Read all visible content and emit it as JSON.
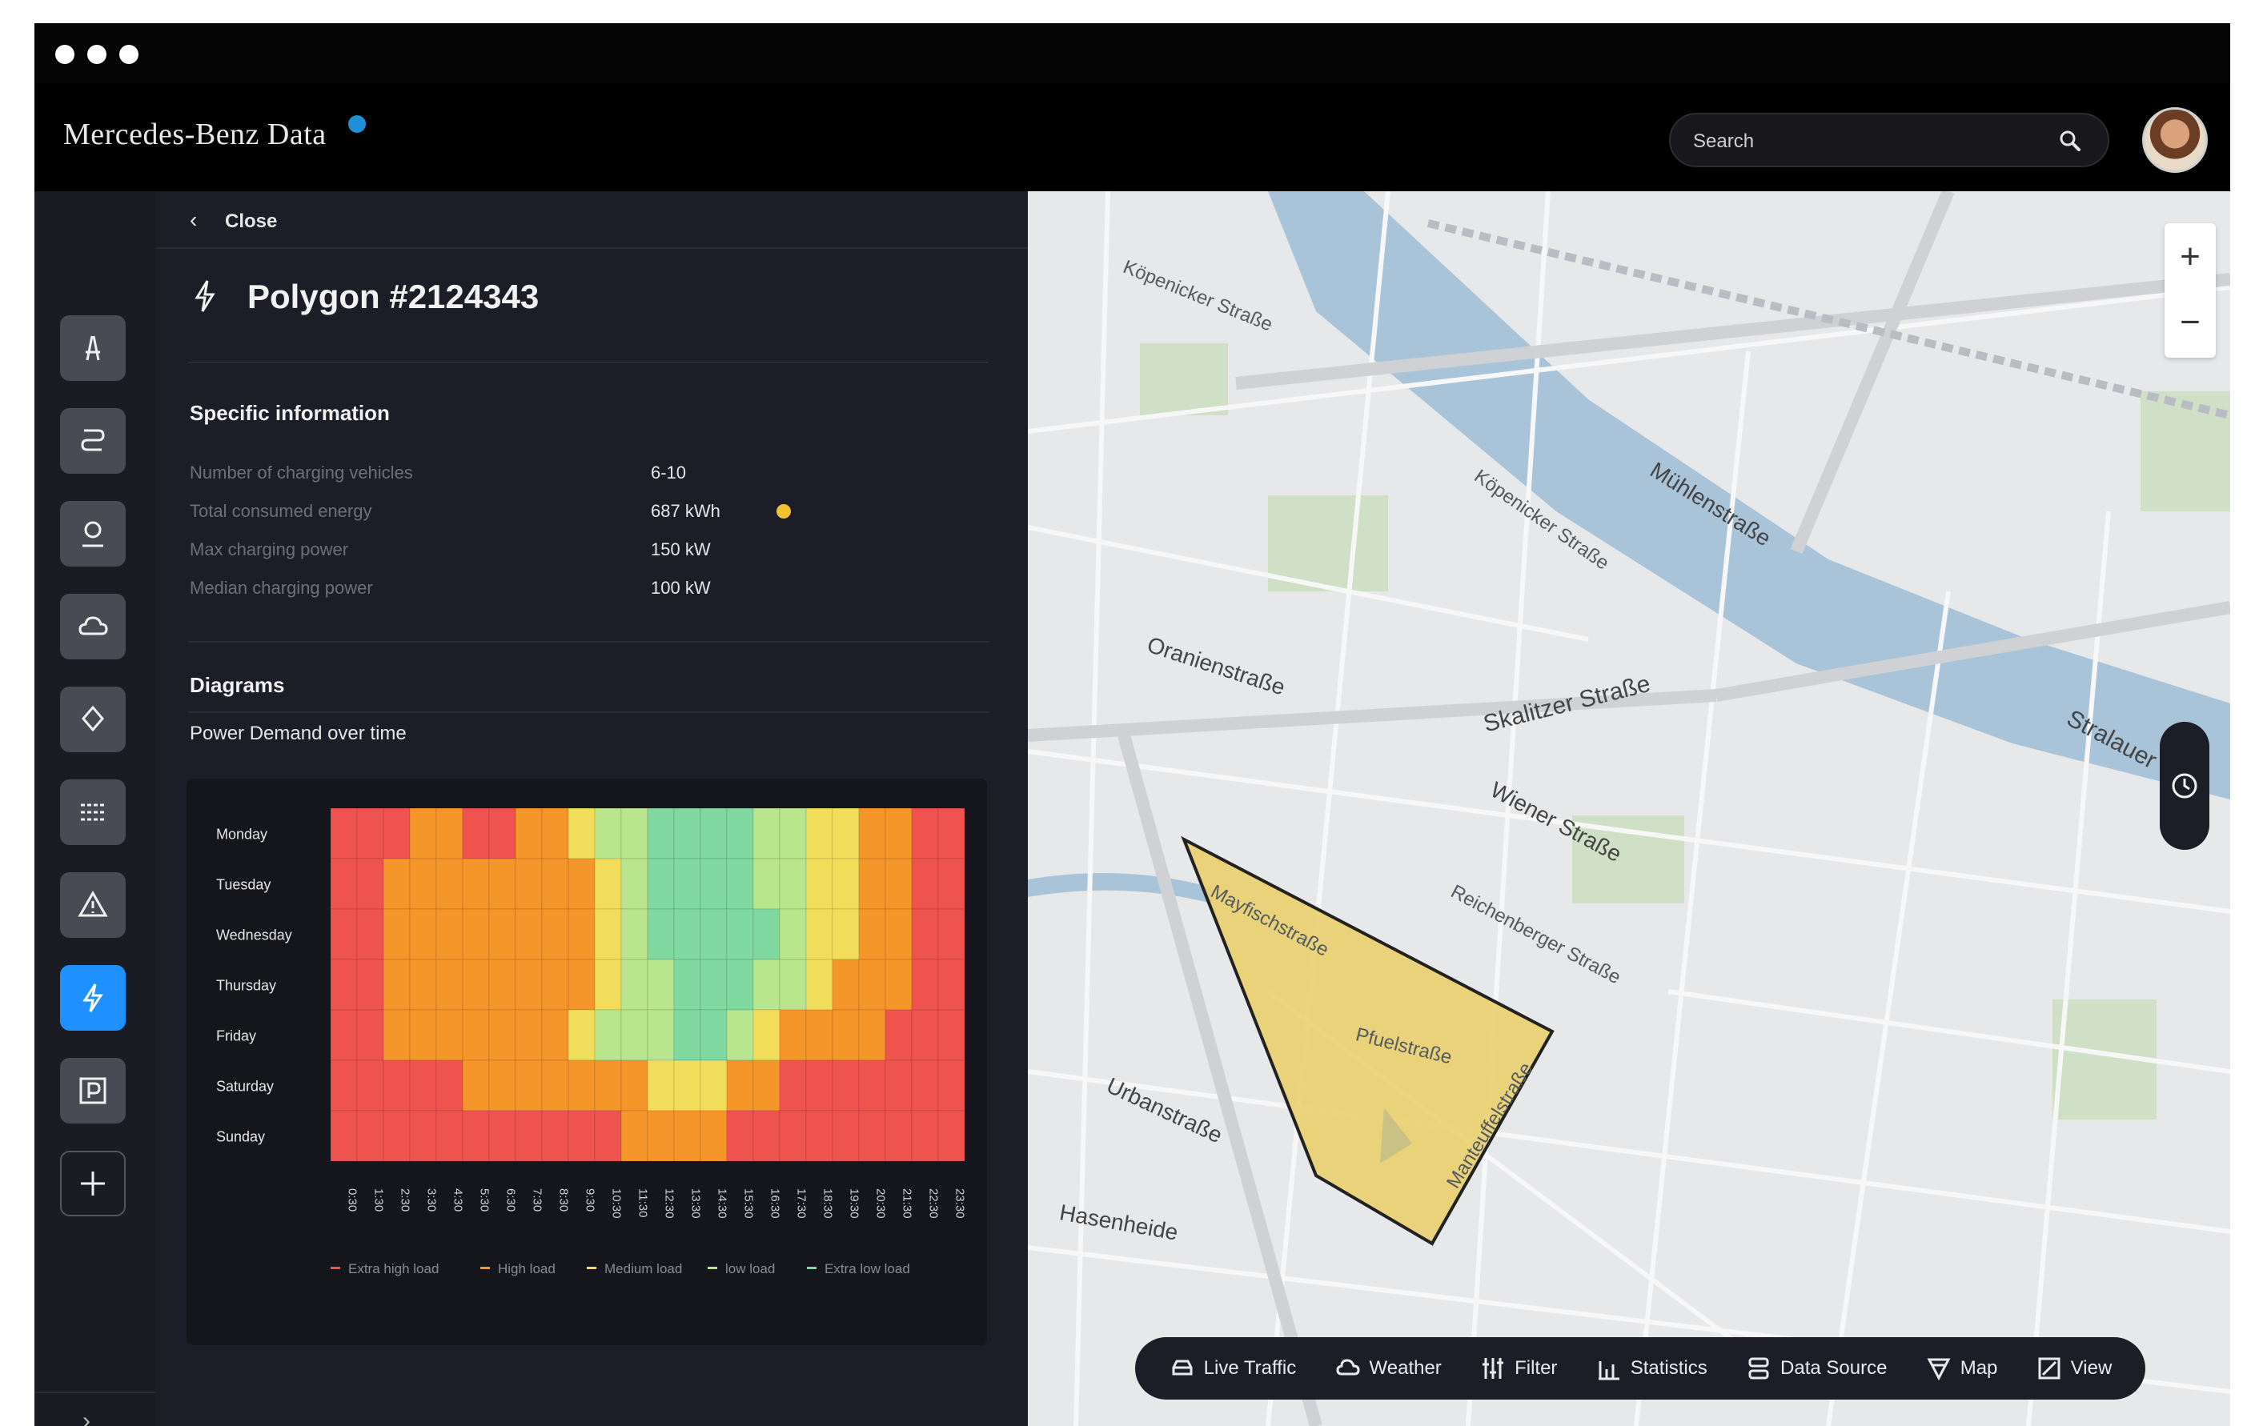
{
  "window": {
    "controls": [
      "close",
      "minimize",
      "maximize"
    ]
  },
  "header": {
    "brand": "Mercedes-Benz Data",
    "search_placeholder": "Search",
    "search_icon": "search-icon",
    "avatar": "user-avatar"
  },
  "rail": {
    "items": [
      {
        "icon": "road-icon",
        "active": false
      },
      {
        "icon": "route-icon",
        "active": false
      },
      {
        "icon": "location-person-icon",
        "active": false
      },
      {
        "icon": "cloud-icon",
        "active": false
      },
      {
        "icon": "pin-icon",
        "active": false
      },
      {
        "icon": "lanes-icon",
        "active": false
      },
      {
        "icon": "warning-icon",
        "active": false
      },
      {
        "icon": "charging-bolt-icon",
        "active": true
      },
      {
        "icon": "parking-icon",
        "active": false
      },
      {
        "icon": "add-icon",
        "active": false
      }
    ],
    "expand": "›"
  },
  "panel": {
    "close_label": "Close",
    "title": "Polygon #2124343",
    "specific_heading": "Specific information",
    "info": [
      {
        "label": "Number of charging vehicles",
        "value": "6-10"
      },
      {
        "label": "Total consumed energy",
        "value": "687 kWh"
      },
      {
        "label": "Max charging power",
        "value": "150 kW"
      },
      {
        "label": "Median charging power",
        "value": "100 kW"
      }
    ],
    "energy_indicator_color": "#f2c230",
    "diagrams_heading": "Diagrams",
    "chart_heading": "Power Demand over time"
  },
  "chart_data": {
    "type": "heatmap",
    "title": "Power Demand over time",
    "rows": [
      "Monday",
      "Tuesday",
      "Wednesday",
      "Thursday",
      "Friday",
      "Saturday",
      "Sunday"
    ],
    "columns": [
      "0:30",
      "1:30",
      "2:30",
      "3:30",
      "4:30",
      "5:30",
      "6:30",
      "7:30",
      "8:30",
      "9:30",
      "10:30",
      "11:30",
      "12:30",
      "13:30",
      "14:30",
      "15:30",
      "16:30",
      "17:30",
      "18:30",
      "19:30",
      "20:30",
      "21:30",
      "22:30",
      "23:30"
    ],
    "levels": [
      "Extra high load",
      "High load",
      "Medium load",
      "low load",
      "Extra low load"
    ],
    "level_colors": [
      "#ef5350",
      "#f5962a",
      "#f2dd5a",
      "#b9e58d",
      "#7fd9a0"
    ],
    "values": [
      [
        0,
        0,
        0,
        1,
        1,
        0,
        0,
        1,
        1,
        2,
        3,
        3,
        4,
        4,
        4,
        4,
        3,
        3,
        2,
        2,
        1,
        1,
        0,
        0
      ],
      [
        0,
        0,
        1,
        1,
        1,
        1,
        1,
        1,
        1,
        1,
        2,
        3,
        4,
        4,
        4,
        4,
        3,
        3,
        2,
        2,
        1,
        1,
        0,
        0
      ],
      [
        0,
        0,
        1,
        1,
        1,
        1,
        1,
        1,
        1,
        1,
        2,
        3,
        4,
        4,
        4,
        4,
        4,
        3,
        2,
        2,
        1,
        1,
        0,
        0
      ],
      [
        0,
        0,
        1,
        1,
        1,
        1,
        1,
        1,
        1,
        1,
        2,
        3,
        3,
        4,
        4,
        4,
        3,
        3,
        2,
        1,
        1,
        1,
        0,
        0
      ],
      [
        0,
        0,
        1,
        1,
        1,
        1,
        1,
        1,
        1,
        2,
        3,
        3,
        3,
        4,
        4,
        3,
        2,
        1,
        1,
        1,
        1,
        0,
        0,
        0
      ],
      [
        0,
        0,
        0,
        0,
        0,
        1,
        1,
        1,
        1,
        1,
        1,
        1,
        2,
        2,
        2,
        1,
        1,
        0,
        0,
        0,
        0,
        0,
        0,
        0
      ],
      [
        0,
        0,
        0,
        0,
        0,
        0,
        0,
        0,
        0,
        0,
        0,
        1,
        1,
        1,
        1,
        0,
        0,
        0,
        0,
        0,
        0,
        0,
        0,
        0
      ]
    ]
  },
  "map": {
    "streets": [
      "Köpenicker Straße",
      "Mühlenstraße",
      "Köpenicker Straße",
      "Oranienstraße",
      "Skalitzer Straße",
      "Wiener Straße",
      "Stralauer",
      "Urbanstraße",
      "Hasenheide",
      "Reichenberger Straße",
      "Pfuelstraße",
      "Mayfischstraße",
      "Manteuffelstraße"
    ],
    "polygon_fill": "#e9cf6e",
    "zoom_in": "+",
    "zoom_out": "−"
  },
  "toolbar": {
    "items": [
      {
        "label": "Live Traffic",
        "icon": "car-icon"
      },
      {
        "label": "Weather",
        "icon": "weather-icon"
      },
      {
        "label": "Filter",
        "icon": "filter-icon"
      },
      {
        "label": "Statistics",
        "icon": "statistics-icon"
      },
      {
        "label": "Data Source",
        "icon": "data-source-icon"
      },
      {
        "label": "Map",
        "icon": "map-icon"
      },
      {
        "label": "View",
        "icon": "view-icon"
      }
    ]
  }
}
